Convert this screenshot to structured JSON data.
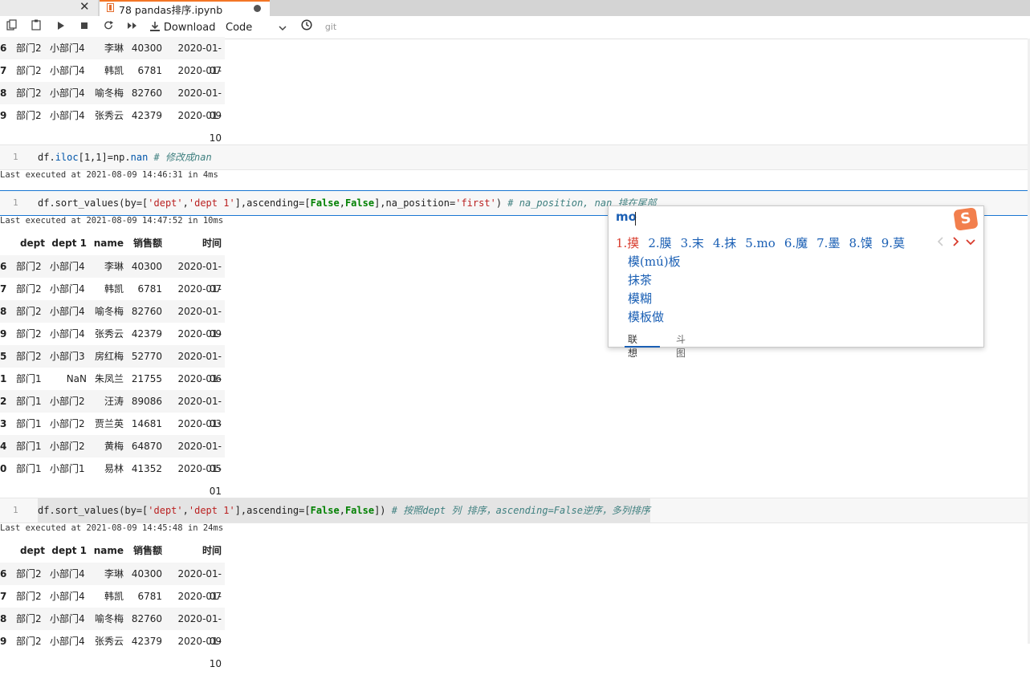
{
  "tabs": {
    "close_glyph": "✕",
    "active_title": "78 pandas排序.ipynb"
  },
  "toolbar": {
    "download_label": "Download",
    "cell_type": "Code",
    "git_label": "git"
  },
  "output_top": {
    "rows": [
      {
        "idx": "6",
        "dept": "部门2",
        "dept1": "小部门4",
        "name": "李琳",
        "sales": "40300",
        "time": "2020-01-07"
      },
      {
        "idx": "7",
        "dept": "部门2",
        "dept1": "小部门4",
        "name": "韩凯",
        "sales": "6781",
        "time": "2020-01-08"
      },
      {
        "idx": "8",
        "dept": "部门2",
        "dept1": "小部门4",
        "name": "喻冬梅",
        "sales": "82760",
        "time": "2020-01-09"
      },
      {
        "idx": "9",
        "dept": "部门2",
        "dept1": "小部门4",
        "name": "张秀云",
        "sales": "42379",
        "time": "2020-01-10"
      }
    ]
  },
  "cells": [
    {
      "line_no": "1",
      "code_parts": [
        "df.",
        "iloc",
        "[1,1]=np.",
        "nan",
        " # ",
        "修改成nan"
      ],
      "exec": "Last executed at 2021-08-09 14:46:31 in 4ms"
    },
    {
      "line_no": "1",
      "code_parts": [
        "df.sort_values(by=[",
        "'dept'",
        ",",
        "'dept 1'",
        "],ascending=[",
        "False",
        ",",
        "False",
        "],na_position=",
        "'first'",
        ") ",
        "# na_position, nan 排在尾部"
      ],
      "exec": "Last executed at 2021-08-09 14:47:52 in 10ms"
    },
    {
      "line_no": "1",
      "code_parts": [
        "df.sort_values(by=[",
        "'dept'",
        ",",
        "'dept 1'",
        "],ascending=[",
        "False",
        ",",
        "False",
        "]) ",
        "# 按照dept 列 排序，ascending=False逆序，多列排序"
      ],
      "exec": "Last executed at 2021-08-09 14:45:48 in 24ms"
    }
  ],
  "table_header": {
    "dept": "dept",
    "dept1": "dept 1",
    "name": "name",
    "sales": "销售额",
    "time": "时间"
  },
  "output_mid": {
    "rows": [
      {
        "idx": "6",
        "dept": "部门2",
        "dept1": "小部门4",
        "name": "李琳",
        "sales": "40300",
        "time": "2020-01-07"
      },
      {
        "idx": "7",
        "dept": "部门2",
        "dept1": "小部门4",
        "name": "韩凯",
        "sales": "6781",
        "time": "2020-01-08"
      },
      {
        "idx": "8",
        "dept": "部门2",
        "dept1": "小部门4",
        "name": "喻冬梅",
        "sales": "82760",
        "time": "2020-01-09"
      },
      {
        "idx": "9",
        "dept": "部门2",
        "dept1": "小部门4",
        "name": "张秀云",
        "sales": "42379",
        "time": "2020-01-10"
      },
      {
        "idx": "5",
        "dept": "部门2",
        "dept1": "小部门3",
        "name": "房红梅",
        "sales": "52770",
        "time": "2020-01-06"
      },
      {
        "idx": "1",
        "dept": "部门1",
        "dept1": "NaN",
        "name": "朱凤兰",
        "sales": "21755",
        "time": "2020-01-02"
      },
      {
        "idx": "2",
        "dept": "部门1",
        "dept1": "小部门2",
        "name": "汪涛",
        "sales": "89086",
        "time": "2020-01-03"
      },
      {
        "idx": "3",
        "dept": "部门1",
        "dept1": "小部门2",
        "name": "贾兰英",
        "sales": "14681",
        "time": "2020-01-04"
      },
      {
        "idx": "4",
        "dept": "部门1",
        "dept1": "小部门2",
        "name": "黄梅",
        "sales": "64870",
        "time": "2020-01-05"
      },
      {
        "idx": "0",
        "dept": "部门1",
        "dept1": "小部门1",
        "name": "易林",
        "sales": "41352",
        "time": "2020-01-01"
      }
    ]
  },
  "output_bottom": {
    "rows": [
      {
        "idx": "6",
        "dept": "部门2",
        "dept1": "小部门4",
        "name": "李琳",
        "sales": "40300",
        "time": "2020-01-07"
      },
      {
        "idx": "7",
        "dept": "部门2",
        "dept1": "小部门4",
        "name": "韩凯",
        "sales": "6781",
        "time": "2020-01-08"
      },
      {
        "idx": "8",
        "dept": "部门2",
        "dept1": "小部门4",
        "name": "喻冬梅",
        "sales": "82760",
        "time": "2020-01-09"
      },
      {
        "idx": "9",
        "dept": "部门2",
        "dept1": "小部门4",
        "name": "张秀云",
        "sales": "42379",
        "time": "2020-01-10"
      }
    ]
  },
  "ime": {
    "input": "mo",
    "logo": "S",
    "candidates": [
      "1.摸",
      "2.膜",
      "3.末",
      "4.抹",
      "5.mo",
      "6.魔",
      "7.墨",
      "8.馍",
      "9.莫"
    ],
    "suggestions": [
      "模(mú)板",
      "抹茶",
      "模糊",
      "模板做"
    ],
    "tab_active": "联想",
    "tab_inactive": "斗图"
  },
  "colors": {
    "accent": "#f37626",
    "active_cell": "#1976d2",
    "ime_text": "#1a5fb4"
  }
}
